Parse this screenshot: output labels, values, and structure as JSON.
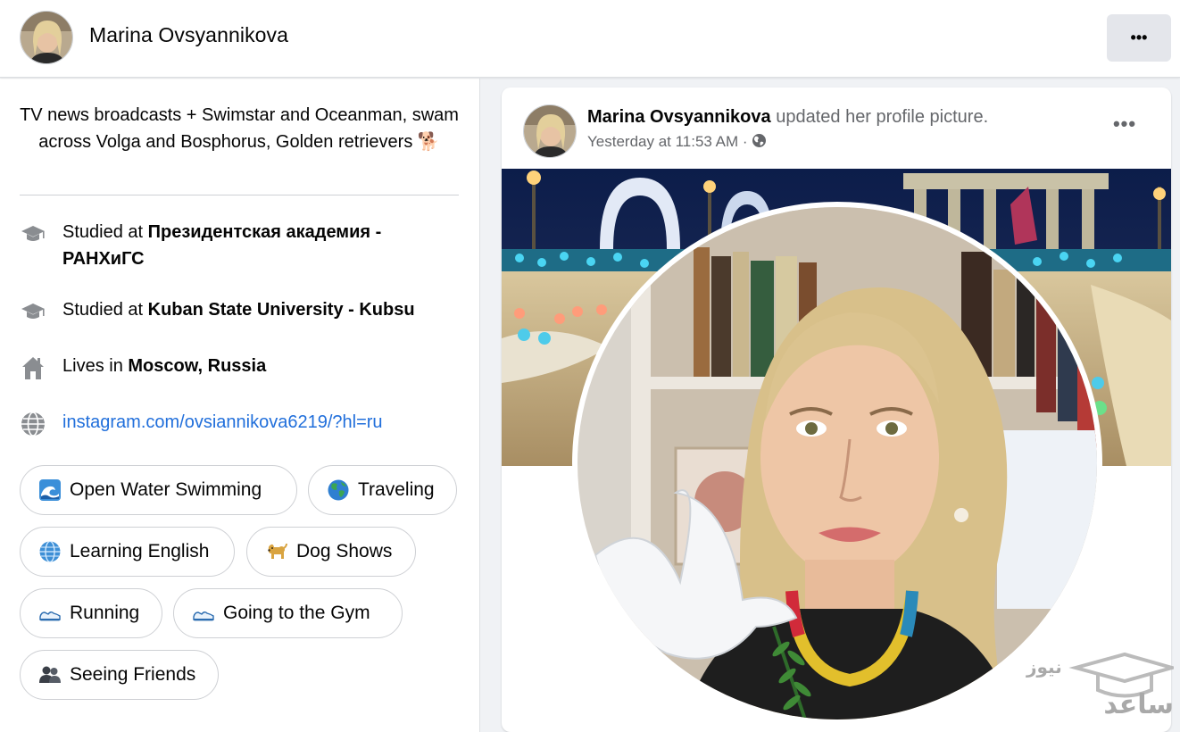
{
  "header": {
    "name": "Marina Ovsyannikova",
    "more_label": "•••"
  },
  "intro": {
    "bio": "TV news broadcasts + Swimstar and Oceanman, swam across Volga and Bosphorus, Golden retrievers 🐕",
    "education": [
      {
        "prefix": "Studied at ",
        "place": "Президентская академия - РАНХиГС",
        "icon": "graduation-cap-icon"
      },
      {
        "prefix": "Studied at ",
        "place": "Kuban State University - Kubsu",
        "icon": "graduation-cap-icon"
      }
    ],
    "lives": {
      "prefix": "Lives in ",
      "place": "Moscow, Russia",
      "icon": "house-icon"
    },
    "website": {
      "url": "instagram.com/ovsiannikova6219/?hl=ru",
      "icon": "globe-icon"
    },
    "hobbies": [
      {
        "label": "Open Water Swimming",
        "icon": "wave-icon"
      },
      {
        "label": "Traveling",
        "icon": "earth-icon"
      },
      {
        "label": "Learning English",
        "icon": "globe-meridians-icon"
      },
      {
        "label": "Dog Shows",
        "icon": "dog-icon"
      },
      {
        "label": "Running",
        "icon": "running-shoe-icon"
      },
      {
        "label": "Going to the Gym",
        "icon": "running-shoe-icon"
      },
      {
        "label": "Seeing Friends",
        "icon": "people-silhouette-icon"
      }
    ]
  },
  "post": {
    "author": "Marina Ovsyannikova",
    "action": " updated her profile picture.",
    "timestamp": "Yesterday at 11:53 AM · ",
    "audience_icon": "globe-icon",
    "more_label": "•••"
  },
  "watermark": {
    "main": "ساعد",
    "small": "نیوز"
  },
  "colors": {
    "link": "#216fdb",
    "secondary_text": "#65676b",
    "page_bg": "#f0f2f5"
  }
}
